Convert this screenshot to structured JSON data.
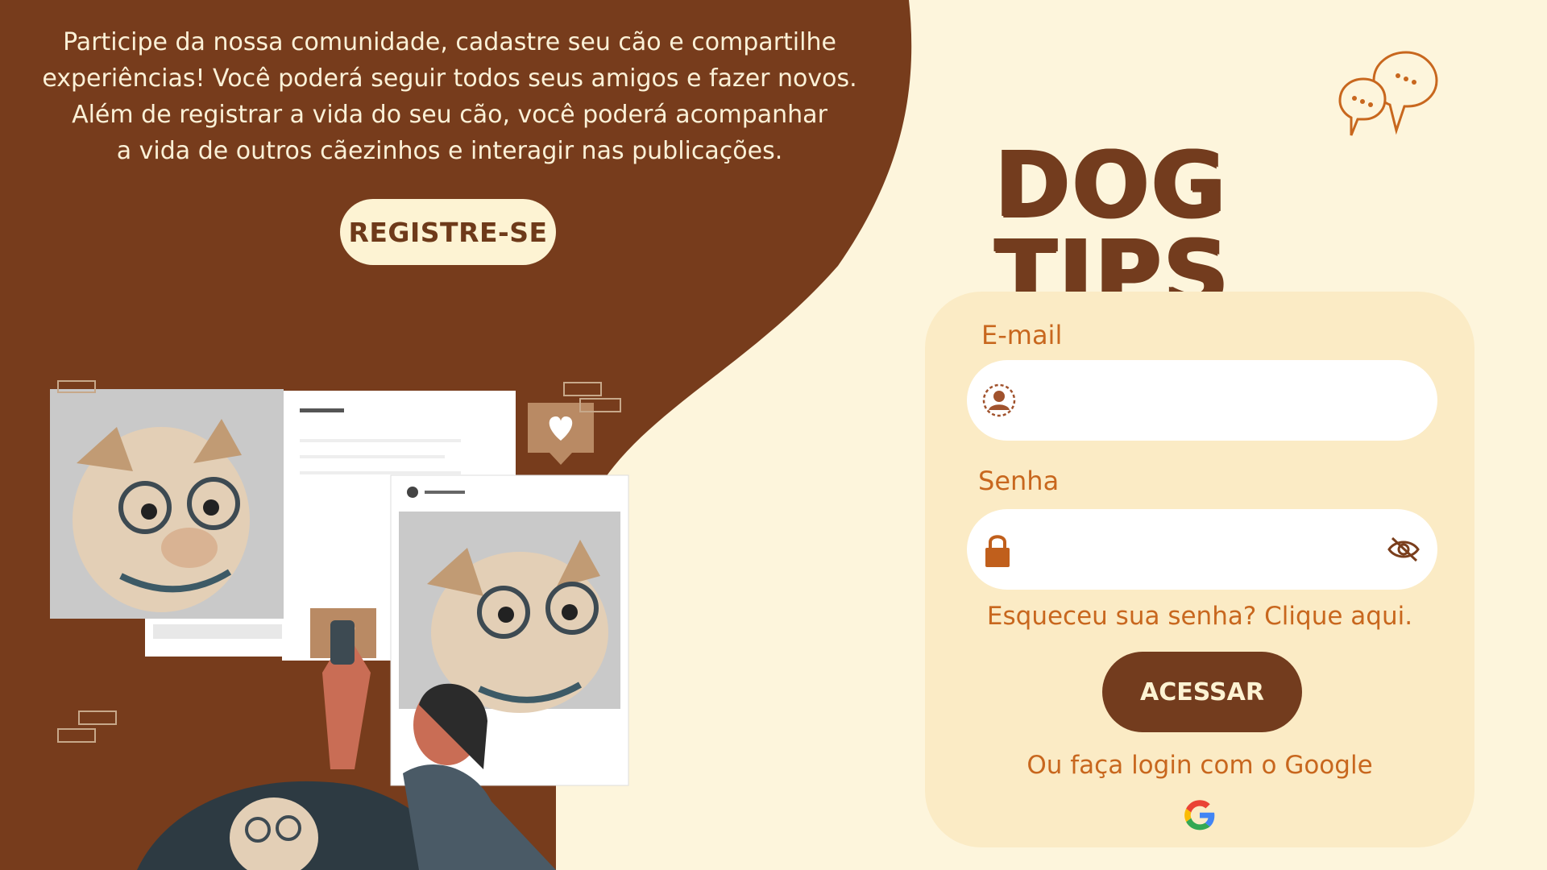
{
  "intro": {
    "lines": [
      "Participe da nossa comunidade, cadastre seu cão e compartilhe",
      "experiências! Você poderá seguir todos seus amigos e fazer novos.",
      "Além de registrar a vida do seu cão, você poderá acompanhar",
      "a vida de outros cãezinhos e interagir nas publicações."
    ],
    "register_label": "REGISTRE-SE"
  },
  "brand": {
    "logo_text": "DOG TIPS"
  },
  "login": {
    "email_label": "E-mail",
    "email_value": "",
    "password_label": "Senha",
    "password_value": "",
    "forgot_text": "Esqueceu sua senha? Clique aqui.",
    "submit_label": "ACESSAR",
    "google_text": "Ou faça login com o Google"
  },
  "icons": {
    "email": "user-circle-icon",
    "password": "lock-icon",
    "toggle_password": "eye-slash-icon",
    "google": "google-icon",
    "logo_decoration": "chat-bubbles-icon"
  },
  "colors": {
    "brown": "#733c1e",
    "cream": "#fdf5dc",
    "card": "#fbebc5",
    "accent_orange": "#c8671e"
  }
}
